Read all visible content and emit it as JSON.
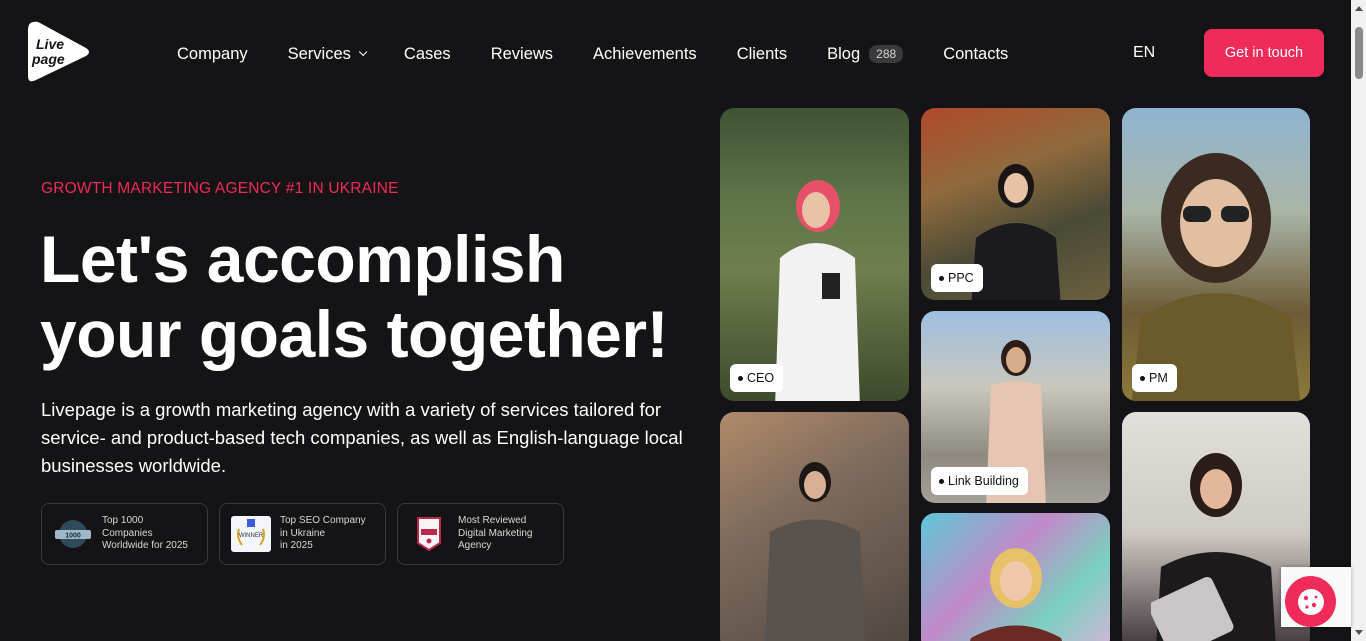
{
  "brand": {
    "logo_line1": "Live",
    "logo_line2": "page",
    "accent_color": "#ef2b5a",
    "background": "#141315"
  },
  "nav": {
    "items": [
      {
        "label": "Company"
      },
      {
        "label": "Services"
      },
      {
        "label": "Cases"
      },
      {
        "label": "Reviews"
      },
      {
        "label": "Achievements"
      },
      {
        "label": "Clients"
      },
      {
        "label": "Blog",
        "badge": "288"
      },
      {
        "label": "Contacts"
      }
    ],
    "language": "EN",
    "cta_label": "Get in touch"
  },
  "hero": {
    "eyebrow": "GROWTH MARKETING AGENCY #1 IN UKRAINE",
    "headline_line1": "Let's accomplish",
    "headline_line2": "your goals together!",
    "description": "Livepage is a growth marketing agency with a variety of services tailored for service- and product-based tech companies, as well as English-language local businesses worldwide."
  },
  "awards": [
    {
      "icon": "clutch-1000-icon",
      "line1": "Top 1000",
      "line2": "Companies",
      "line3": "Worldwide for 2025",
      "icon_label": "1000"
    },
    {
      "icon": "seo-winner-icon",
      "line1": "Top SEO Company",
      "line2": "in Ukraine",
      "line3": "in 2025",
      "icon_label": "WINNER"
    },
    {
      "icon": "most-reviewed-shield-icon",
      "line1": "Most Reviewed",
      "line2": "Digital Marketing",
      "line3": "Agency"
    }
  ],
  "team": [
    {
      "role": "CEO"
    },
    {
      "role": "PPC"
    },
    {
      "role": "PM"
    },
    {
      "role": "Link Building"
    }
  ]
}
